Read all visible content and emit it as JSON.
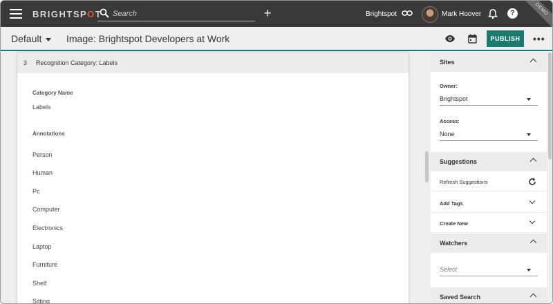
{
  "topbar": {
    "logo_text": "BRIGHTSP",
    "logo_dot": "O",
    "logo_tail": "T",
    "search_placeholder": "Search",
    "site_name": "Brightspot",
    "user_name": "Mark Hoover",
    "help_label": "?",
    "plus_label": "+",
    "ribbon_text": "DEMO"
  },
  "subbar": {
    "variation": "Default",
    "content_title": "Image: Brightspot Developers at Work",
    "publish_label": "PUBLISH",
    "more_label": "•••"
  },
  "main": {
    "header_number": "3",
    "header_title": "Recognition Category: Labels",
    "category_name_label": "Category Name",
    "category_name_value": "Labels",
    "annotations_label": "Annotations",
    "annotations": [
      "Person",
      "Human",
      "Pc",
      "Computer",
      "Electronics",
      "Laptop",
      "Furniture",
      "Shelf",
      "Sitting"
    ]
  },
  "sidebar": {
    "sites": {
      "title": "Sites",
      "owner_label": "Owner:",
      "owner_value": "Brightspot",
      "access_label": "Access:",
      "access_value": "None"
    },
    "suggestions": {
      "title": "Suggestions",
      "refresh_label": "Refresh Suggestions",
      "add_tags_label": "Add Tags",
      "create_new_label": "Create New"
    },
    "watchers": {
      "title": "Watchers",
      "select_placeholder": "Select"
    },
    "saved_search": {
      "title": "Saved Search"
    }
  },
  "colors": {
    "accent": "#1b7a6f",
    "topbar_bg": "#3b3937",
    "logo_dot": "#e2503c"
  },
  "icons": [
    "hamburger-icon",
    "search-icon",
    "plus-icon",
    "link-icon",
    "bell-icon",
    "help-icon",
    "eye-icon",
    "calendar-icon",
    "refresh-icon",
    "chevron-up-icon",
    "chevron-down-icon"
  ]
}
